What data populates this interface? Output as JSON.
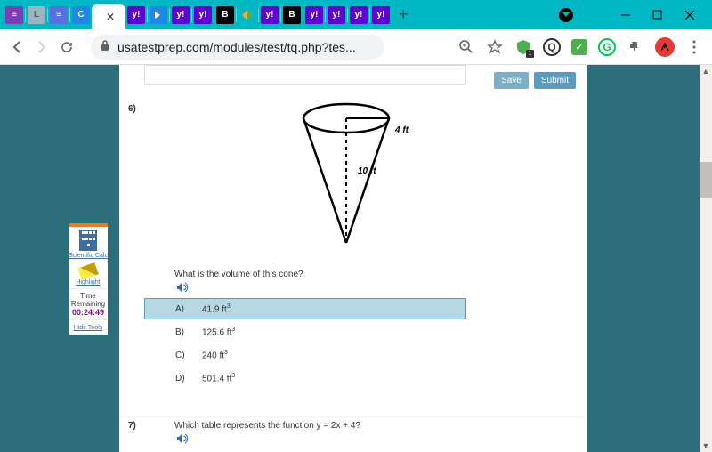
{
  "browser": {
    "url_display": "usatestprep.com/modules/test/tq.php?tes...",
    "tabs_count": 15,
    "new_tab": "+"
  },
  "actions": {
    "save": "Save",
    "submit": "Submit"
  },
  "tools_panel": {
    "calc": "Scientific Calc",
    "highlight": "Highlight",
    "time_label": "Time Remaining",
    "time_value": "00:24:49",
    "hide": "Hide Tools"
  },
  "q6": {
    "number": "6)",
    "radius_label": "4 ft",
    "height_label": "10 ft",
    "prompt": "What is the volume of this cone?",
    "choices": [
      {
        "letter": "A)",
        "value": "41.9 ft",
        "exp": "3",
        "selected": true
      },
      {
        "letter": "B)",
        "value": "125.6 ft",
        "exp": "3",
        "selected": false
      },
      {
        "letter": "C)",
        "value": "240 ft",
        "exp": "3",
        "selected": false
      },
      {
        "letter": "D)",
        "value": "501.4 ft",
        "exp": "3",
        "selected": false
      }
    ]
  },
  "q7": {
    "number": "7)",
    "prompt": "Which table represents the function y = 2x + 4?"
  }
}
